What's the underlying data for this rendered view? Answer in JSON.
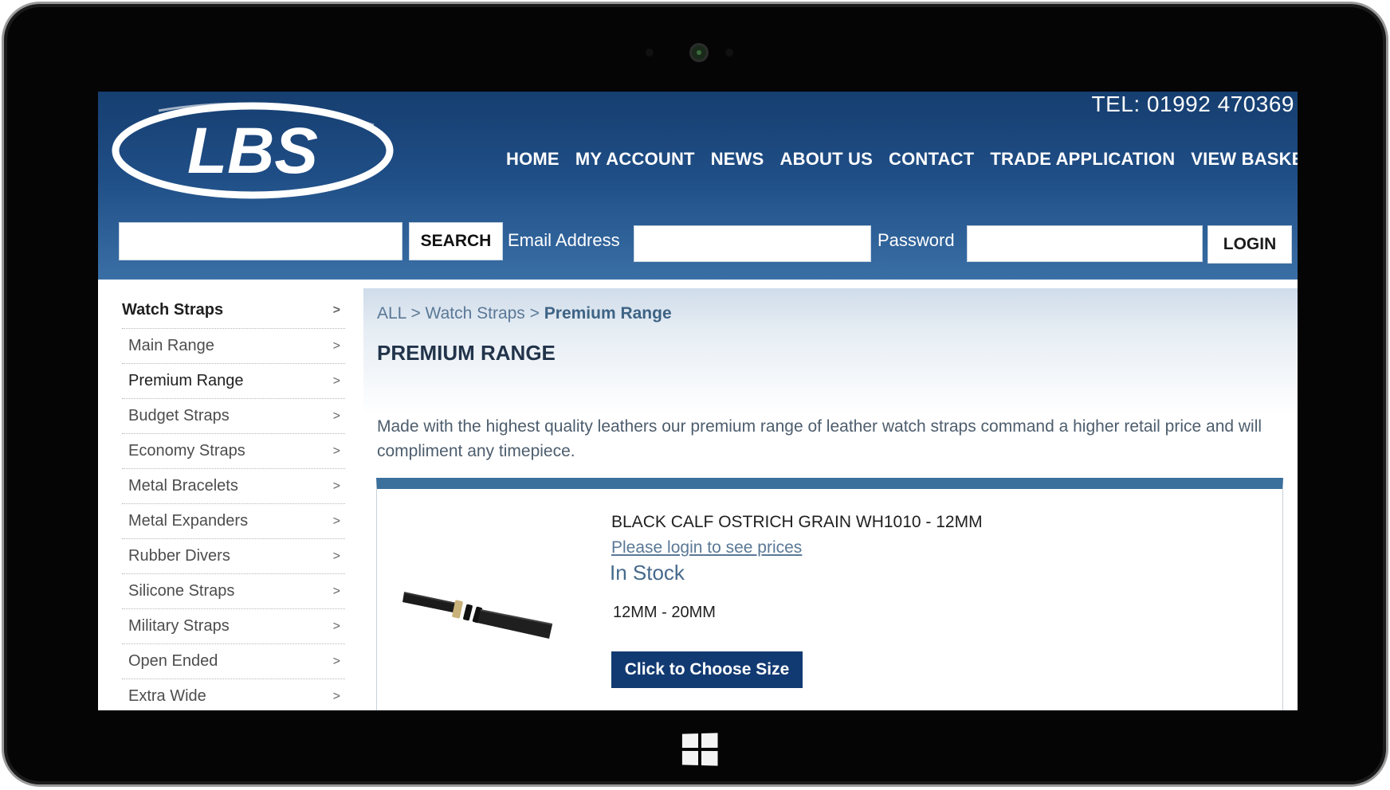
{
  "header": {
    "logo_text": "LBS",
    "tel": "TEL: 01992 470369",
    "nav": [
      "HOME",
      "MY ACCOUNT",
      "NEWS",
      "ABOUT US",
      "CONTACT",
      "TRADE APPLICATION",
      "VIEW BASKET"
    ],
    "search": {
      "value": "",
      "button": "SEARCH"
    },
    "login": {
      "email_label": "Email Address",
      "email_value": "",
      "password_label": "Password",
      "password_value": "",
      "button": "LOGIN"
    }
  },
  "sidebar": {
    "heading": "Watch Straps",
    "chevron": ">",
    "items": [
      "Main Range",
      "Premium Range",
      "Budget Straps",
      "Economy Straps",
      "Metal Bracelets",
      "Metal Expanders",
      "Rubber Divers",
      "Silicone Straps",
      "Military Straps",
      "Open Ended",
      "Extra Wide"
    ],
    "active_index": 1
  },
  "main": {
    "breadcrumb": {
      "root": "ALL",
      "sep": ">",
      "parent": "Watch Straps",
      "current": "Premium Range"
    },
    "title": "PREMIUM RANGE",
    "description": "Made with the highest quality leathers our premium range of leather watch straps command a higher retail price and will compliment any timepiece.",
    "product": {
      "name": "BLACK CALF OSTRICH GRAIN WH1010 - 12MM",
      "price_link": "Please login to see prices",
      "stock": "In Stock",
      "sizes": "12MM - 20MM",
      "button": "Click to Choose Size"
    }
  },
  "colors": {
    "header_dark": "#163e70",
    "header_light": "#3a6fa6",
    "button_dark": "#123a72",
    "product_bar": "#3b6f9c",
    "link": "#5a7896"
  }
}
